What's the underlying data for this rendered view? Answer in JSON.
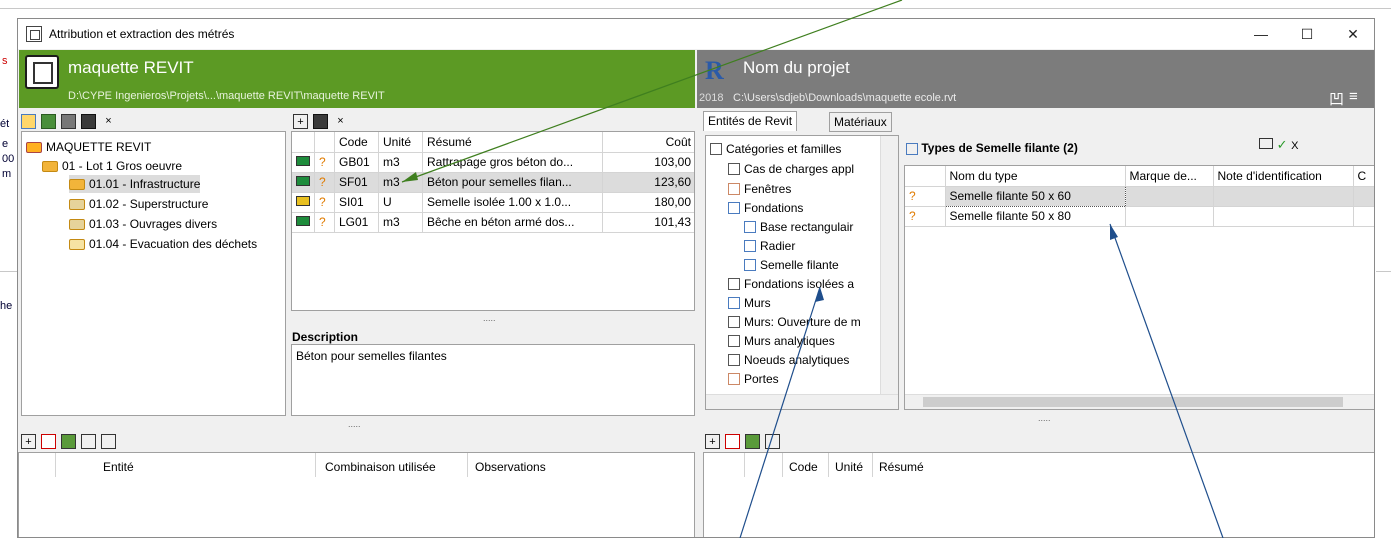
{
  "window": {
    "title": "Attribution et extraction des métrés",
    "minimize": "—",
    "maximize": "☐",
    "close": "✕"
  },
  "left_header": {
    "title": "maquette REVIT",
    "path": "D:\\CYPE Ingenieros\\Projets\\...\\maquette REVIT\\maquette REVIT"
  },
  "right_header": {
    "title": "Nom du projet",
    "year": "2018",
    "path": "C:\\Users\\sdjeb\\Downloads\\maquette ecole.rvt",
    "layout_icon": "凹",
    "menu_icon": "≡"
  },
  "tree": {
    "root": "MAQUETTE REVIT",
    "lot": "01 - Lot 1 Gros oeuvre",
    "items": [
      "01.01 - Infrastructure",
      "01.02 - Superstructure",
      "01.03 - Ouvrages divers",
      "01.04 - Evacuation des déchets"
    ]
  },
  "grid": {
    "headers": [
      "Code",
      "Unité",
      "Résumé",
      "Coût"
    ],
    "rows": [
      {
        "code": "GB01",
        "unit": "m3",
        "summary": "Rattrapage gros béton do...",
        "cost": "103,00",
        "color": "#1e8c3c"
      },
      {
        "code": "SF01",
        "unit": "m3",
        "summary": "Béton pour semelles filan...",
        "cost": "123,60",
        "color": "#1e8c3c"
      },
      {
        "code": "SI01",
        "unit": "U",
        "summary": "Semelle isolée 1.00 x 1.0...",
        "cost": "180,00",
        "color": "#e8c020"
      },
      {
        "code": "LG01",
        "unit": "m3",
        "summary": "Bêche en béton armé dos...",
        "cost": "101,43",
        "color": "#1e8c3c"
      }
    ],
    "q": "?"
  },
  "description": {
    "label": "Description",
    "text": "Béton pour semelles filantes",
    "dots": "....."
  },
  "bottom_left": {
    "headers": [
      "Entité",
      "Combinaison utilisée",
      "Observations"
    ]
  },
  "bottom_right": {
    "headers": [
      "Code",
      "Unité",
      "Résumé"
    ]
  },
  "tabs": {
    "entities": "Entités de Revit",
    "materials": "Matériaux"
  },
  "revit_tree": {
    "header": "Catégories et familles",
    "items": [
      "Cas de charges appl",
      "Fenêtres",
      "Fondations",
      "Base rectangulair",
      "Radier",
      "Semelle filante",
      "Fondations isolées a",
      "Murs",
      "Murs: Ouverture de m",
      "Murs analytiques",
      "Noeuds analytiques",
      "Portes"
    ]
  },
  "types": {
    "title": "Types de Semelle filante (2)",
    "headers": [
      "Nom du type",
      "Marque de...",
      "Note d'identification",
      "C"
    ],
    "rows": [
      "Semelle filante 50 x 60",
      "Semelle filante 50 x 80"
    ],
    "q": "?",
    "check": "✓",
    "cross": "X"
  },
  "toolbar": {
    "close": "×",
    "plus": "+"
  },
  "bg": {
    "left_frag": [
      "s",
      "ét",
      "e",
      "00",
      "m",
      "he"
    ]
  }
}
